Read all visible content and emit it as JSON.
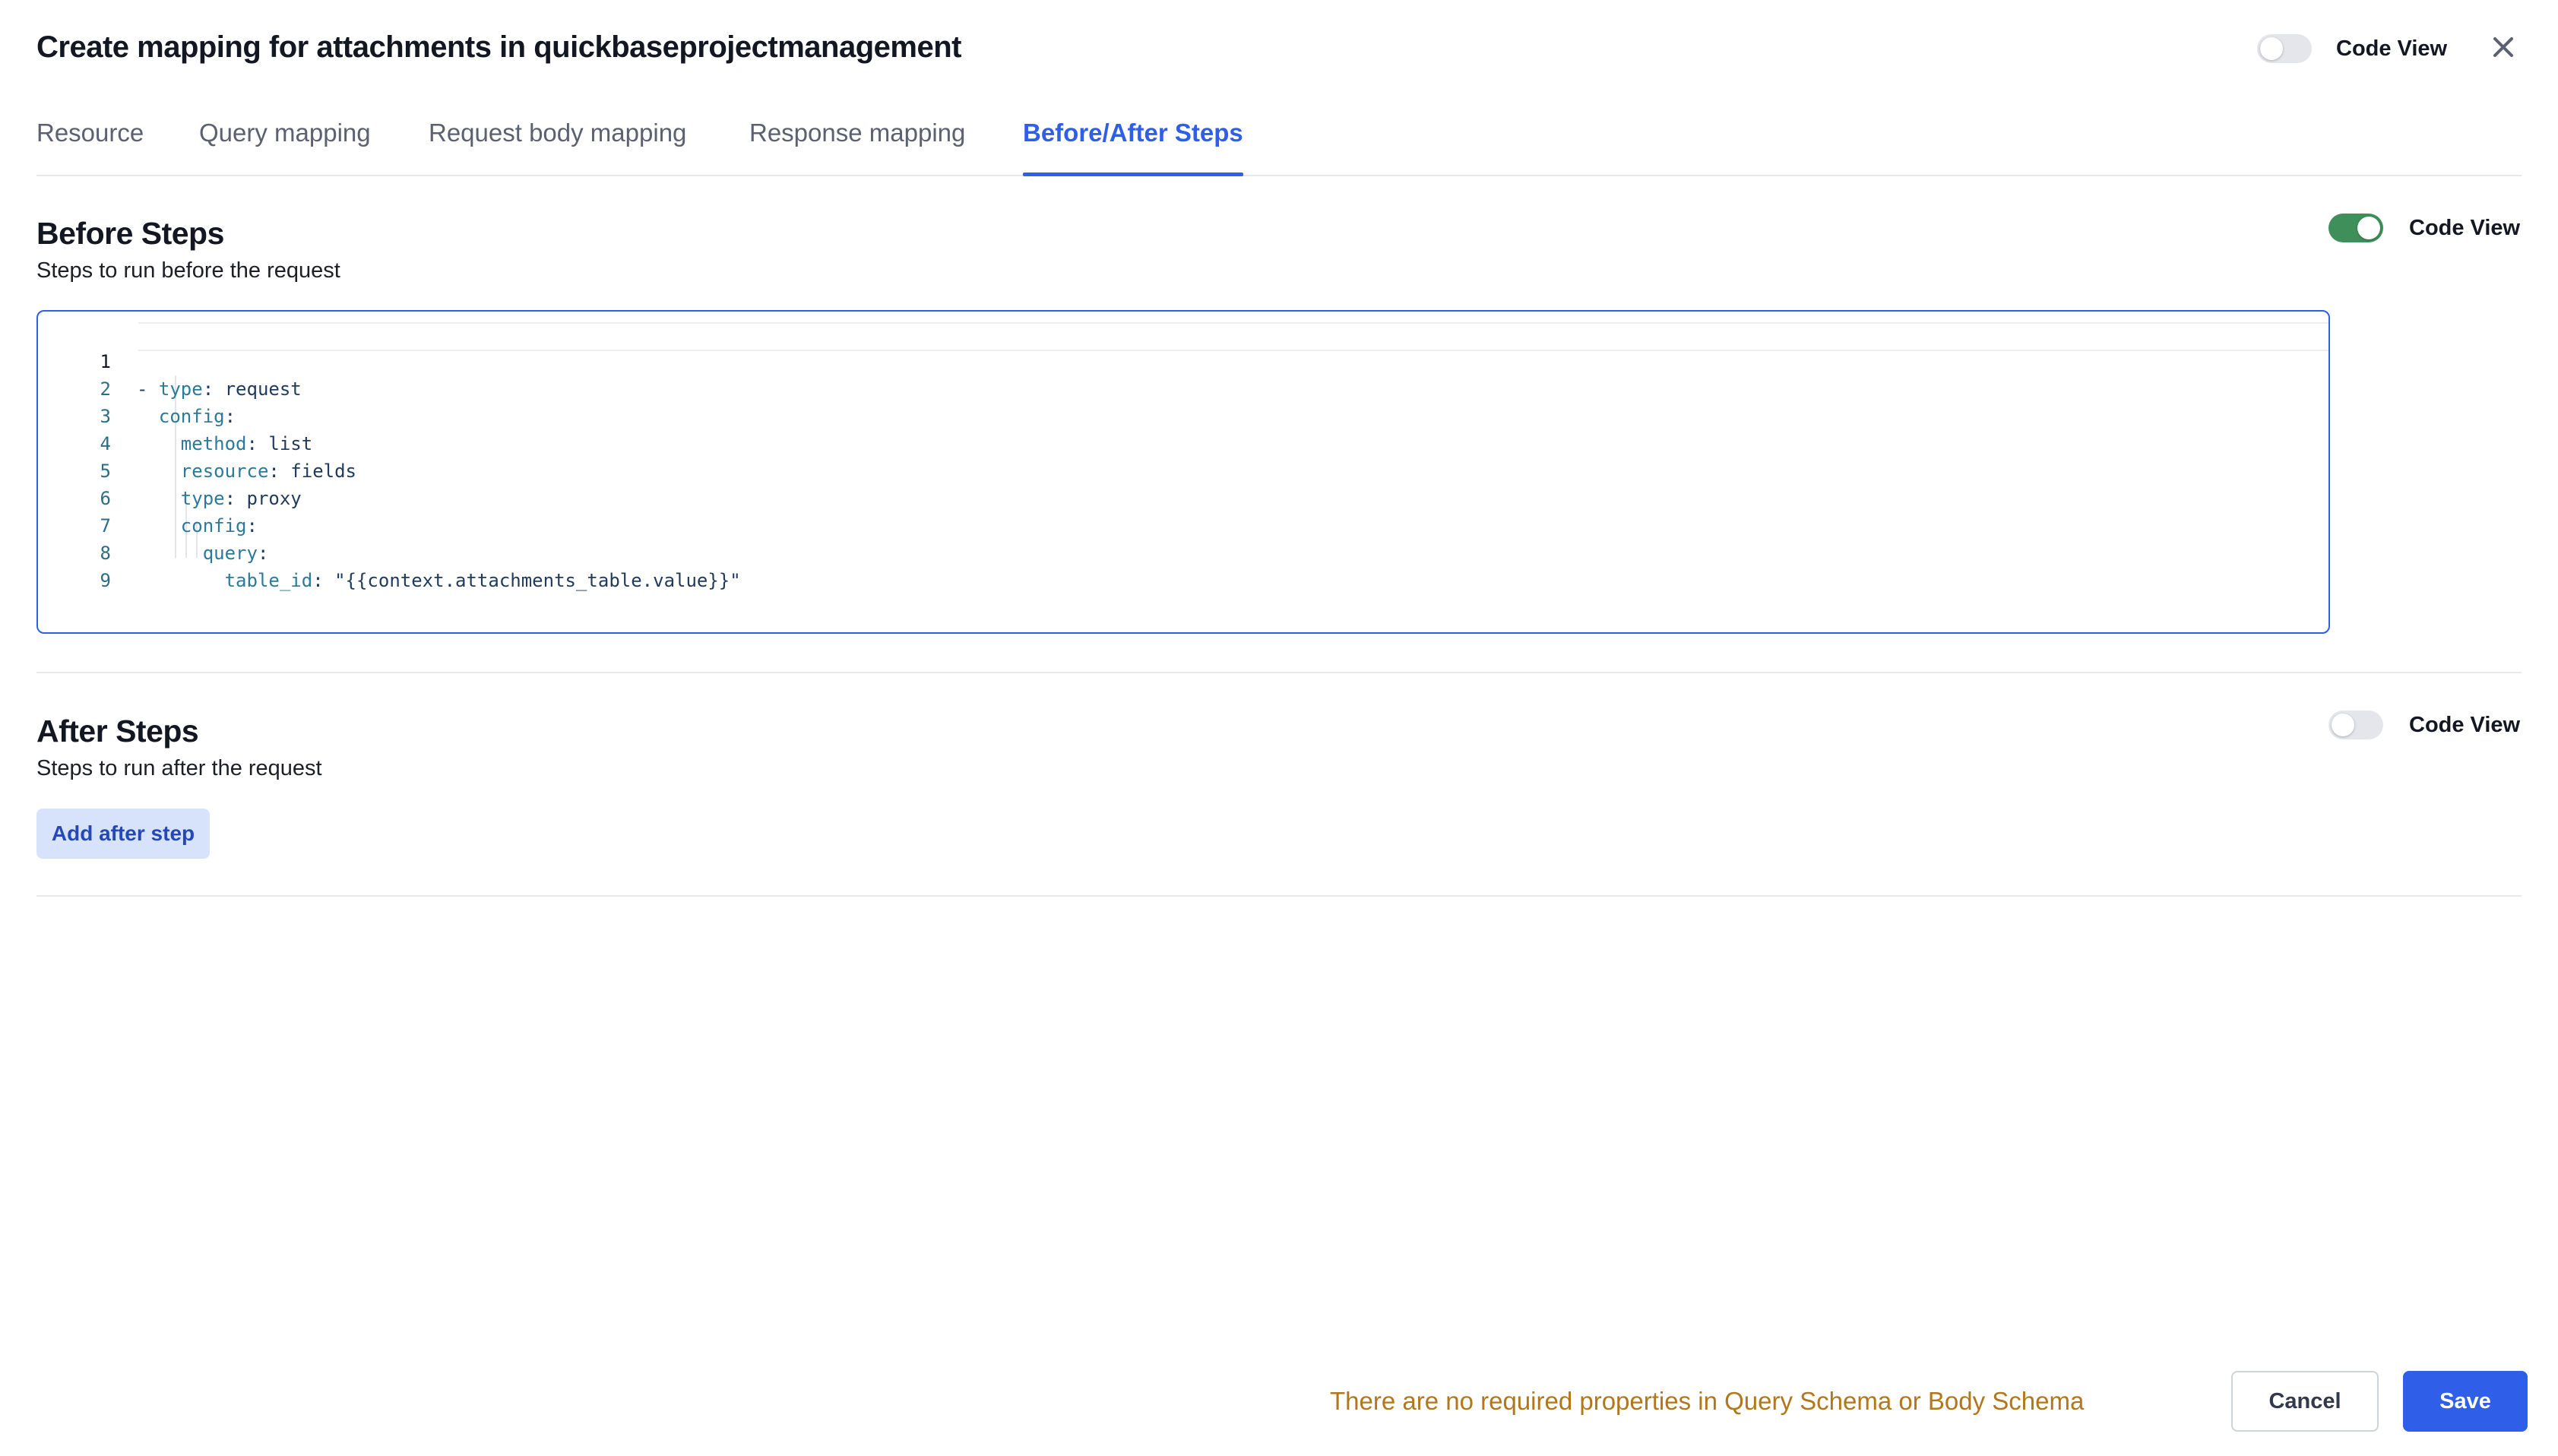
{
  "dialog": {
    "title": "Create mapping for attachments in quickbaseprojectmanagement",
    "code_view_label": "Code View",
    "code_view_enabled": false
  },
  "tabs": [
    {
      "label": "Resource",
      "active": false
    },
    {
      "label": "Query mapping",
      "active": false
    },
    {
      "label": "Request body mapping",
      "active": false
    },
    {
      "label": "Response mapping",
      "active": false
    },
    {
      "label": "Before/After Steps",
      "active": true
    }
  ],
  "before_steps": {
    "title": "Before Steps",
    "subtitle": "Steps to run before the request",
    "code_view_label": "Code View",
    "code_view_enabled": true,
    "code_lines": [
      {
        "n": "1",
        "text": "- type: request"
      },
      {
        "n": "2",
        "text": "  config:"
      },
      {
        "n": "3",
        "text": "    method: list"
      },
      {
        "n": "4",
        "text": "    resource: fields"
      },
      {
        "n": "5",
        "text": "    type: proxy"
      },
      {
        "n": "6",
        "text": "    config:"
      },
      {
        "n": "7",
        "text": "      query:"
      },
      {
        "n": "8",
        "text": "        table_id: \"{{context.attachments_table.value}}\""
      },
      {
        "n": "9",
        "text": ""
      }
    ]
  },
  "after_steps": {
    "title": "After Steps",
    "subtitle": "Steps to run after the request",
    "code_view_label": "Code View",
    "code_view_enabled": false,
    "add_button": "Add after step"
  },
  "footer": {
    "warning": "There are no required properties in Query Schema or Body Schema",
    "cancel": "Cancel",
    "save": "Save"
  },
  "colors": {
    "accent": "#2f5fe8",
    "toggle_on": "#3f8f5b",
    "warning": "#b2771b"
  },
  "icons": {
    "close": "close-icon"
  }
}
